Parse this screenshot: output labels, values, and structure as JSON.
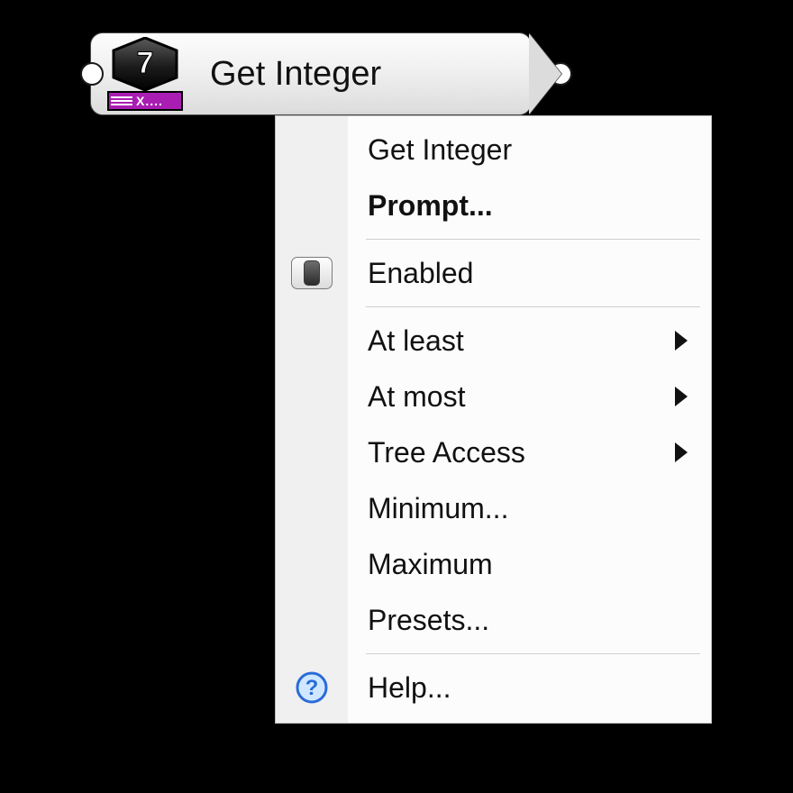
{
  "node": {
    "title": "Get Integer",
    "icon_var_text": "X....",
    "icon_number": "7"
  },
  "menu": {
    "items": [
      {
        "key": "title",
        "label": "Get Integer",
        "bold": false,
        "icon": null,
        "submenu": false,
        "interactable": false
      },
      {
        "key": "prompt",
        "label": "Prompt...",
        "bold": true,
        "icon": null,
        "submenu": false,
        "interactable": true
      },
      {
        "sep": true
      },
      {
        "key": "enabled",
        "label": "Enabled",
        "bold": false,
        "icon": "toggle",
        "submenu": false,
        "interactable": true
      },
      {
        "sep": true
      },
      {
        "key": "atleast",
        "label": "At least",
        "bold": false,
        "icon": null,
        "submenu": true,
        "interactable": true
      },
      {
        "key": "atmost",
        "label": "At most",
        "bold": false,
        "icon": null,
        "submenu": true,
        "interactable": true
      },
      {
        "key": "treeaccess",
        "label": "Tree Access",
        "bold": false,
        "icon": null,
        "submenu": true,
        "interactable": true
      },
      {
        "key": "minimum",
        "label": "Minimum...",
        "bold": false,
        "icon": null,
        "submenu": false,
        "interactable": true
      },
      {
        "key": "maximum",
        "label": "Maximum",
        "bold": false,
        "icon": null,
        "submenu": false,
        "interactable": true
      },
      {
        "key": "presets",
        "label": "Presets...",
        "bold": false,
        "icon": null,
        "submenu": false,
        "interactable": true
      },
      {
        "sep": true
      },
      {
        "key": "help",
        "label": "Help...",
        "bold": false,
        "icon": "help",
        "submenu": false,
        "interactable": true
      }
    ]
  }
}
